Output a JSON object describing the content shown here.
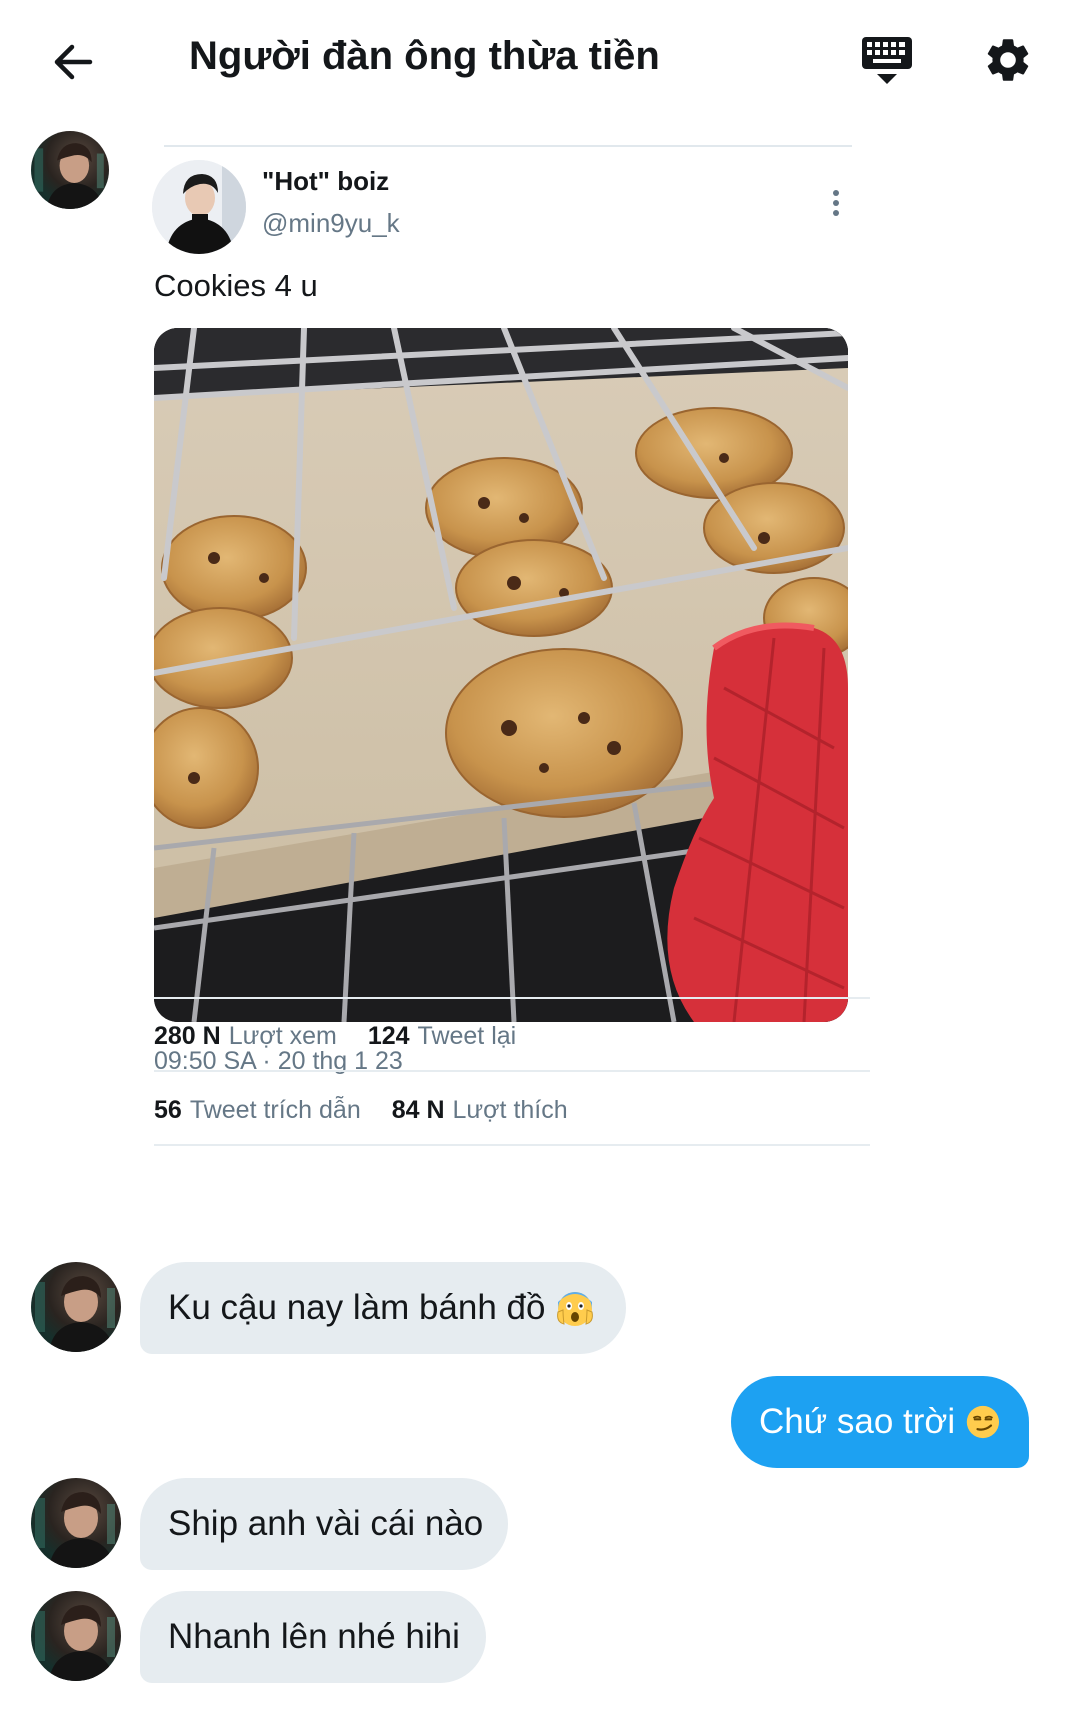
{
  "header": {
    "title": "Người đàn ông thừa tiền",
    "back_icon": "arrow-left-icon",
    "keyboard_icon": "keyboard-icon",
    "settings_icon": "gear-icon"
  },
  "tweet": {
    "author_name": "\"Hot\" boiz",
    "author_handle": "@min9yu_k",
    "text": "Cookies 4 u",
    "media_description_icon": "photo-cookies-in-oven",
    "timestamp": "09:50 SA · 20 thg 1 23",
    "stats": {
      "views_count": "280 N",
      "views_label": "Lượt xem",
      "retweets_count": "124",
      "retweets_label": "Tweet lại",
      "quotes_count": "56",
      "quotes_label": "Tweet trích dẫn",
      "likes_count": "84 N",
      "likes_label": "Lượt thích"
    }
  },
  "messages": [
    {
      "direction": "in",
      "text": "Ku cậu nay làm bánh đồ",
      "emoji": "screaming-face"
    },
    {
      "direction": "out",
      "text": "Chứ sao trời",
      "emoji": "smirking-face"
    },
    {
      "direction": "in",
      "text": "Ship anh vài cái nào"
    },
    {
      "direction": "in",
      "text": "Nhanh lên nhé hihi"
    }
  ],
  "colors": {
    "accent": "#1da1f2",
    "incoming_bubble": "#e6ecf0",
    "secondary_text": "#657786"
  }
}
